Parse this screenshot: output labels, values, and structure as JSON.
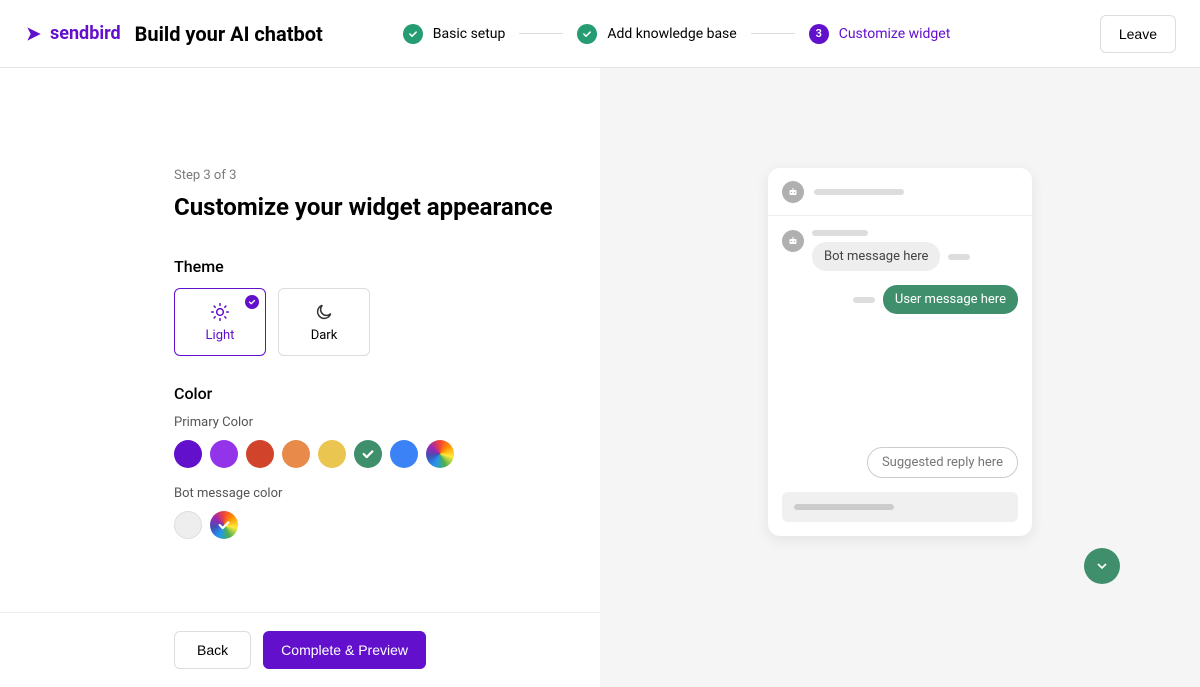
{
  "header": {
    "brand": "sendbird",
    "page_title": "Build your AI chatbot",
    "leave_label": "Leave",
    "steps": [
      {
        "label": "Basic setup",
        "state": "done"
      },
      {
        "label": "Add knowledge base",
        "state": "done"
      },
      {
        "label": "Customize widget",
        "state": "current",
        "number": "3"
      }
    ]
  },
  "main": {
    "step_indicator": "Step 3 of 3",
    "heading": "Customize your widget appearance",
    "theme": {
      "label": "Theme",
      "options": [
        {
          "label": "Light",
          "selected": true
        },
        {
          "label": "Dark",
          "selected": false
        }
      ]
    },
    "color": {
      "label": "Color",
      "primary": {
        "label": "Primary Color",
        "swatches": [
          {
            "hex": "#6210cc",
            "selected": false
          },
          {
            "hex": "#9333ea",
            "selected": false
          },
          {
            "hex": "#d1432a",
            "selected": false
          },
          {
            "hex": "#e88b4a",
            "selected": false
          },
          {
            "hex": "#eac54f",
            "selected": false
          },
          {
            "hex": "#3f8f6c",
            "selected": true
          },
          {
            "hex": "#3b82f6",
            "selected": false
          },
          {
            "hex": "rainbow",
            "selected": false
          }
        ]
      },
      "bot_message": {
        "label": "Bot message color",
        "swatches": [
          {
            "hex": "#eeeeee",
            "selected": false,
            "bordered": true
          },
          {
            "hex": "rainbow",
            "selected": true
          }
        ]
      }
    }
  },
  "footer": {
    "back_label": "Back",
    "complete_label": "Complete & Preview"
  },
  "preview": {
    "bot_message": "Bot message here",
    "user_message": "User message here",
    "suggested_reply": "Suggested reply here",
    "colors": {
      "primary": "#3f8f6c",
      "bot_bubble": "#eeeeee"
    }
  }
}
